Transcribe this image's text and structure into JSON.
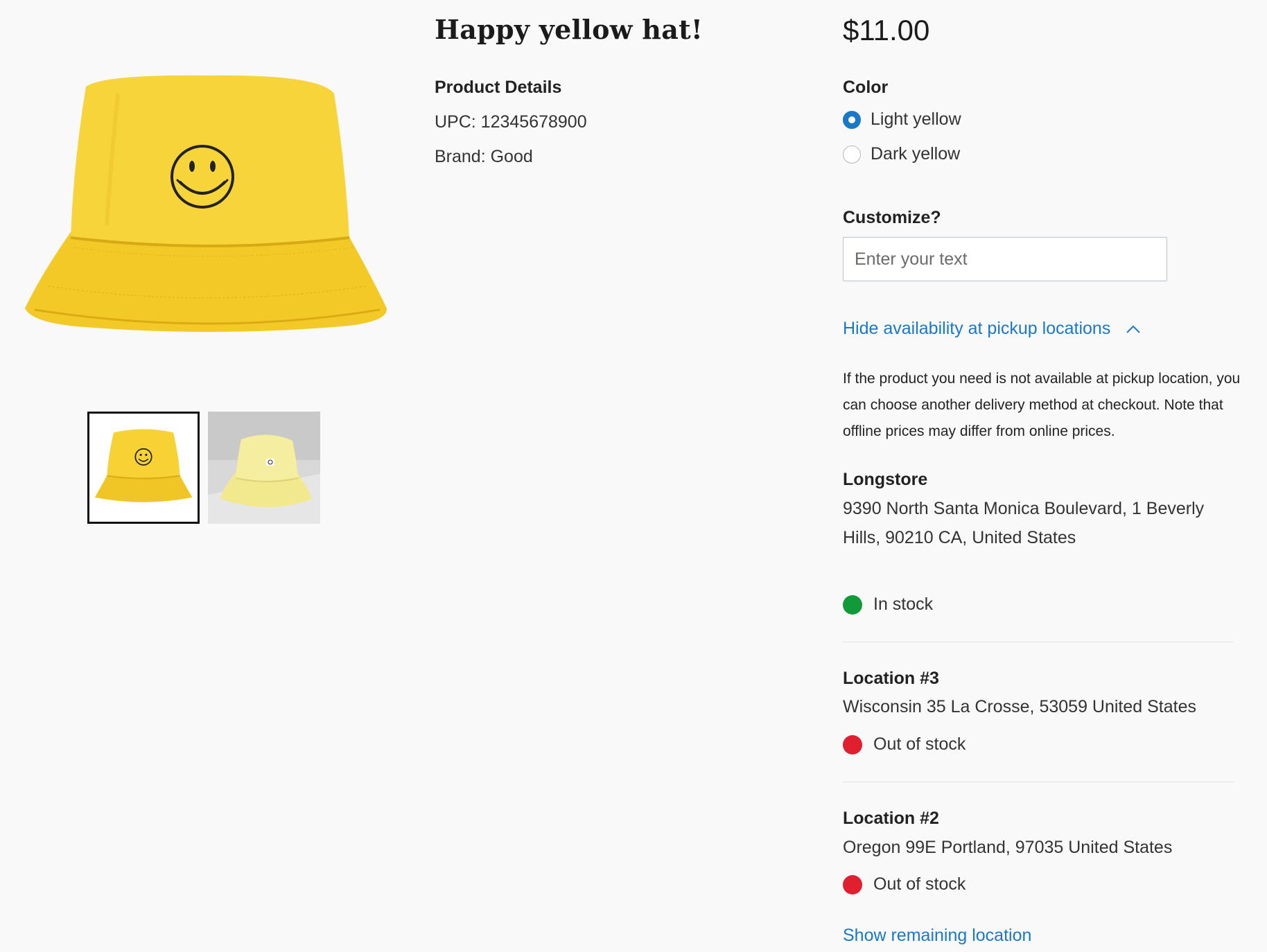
{
  "product": {
    "title": "Happy yellow hat!",
    "price": "$11.00",
    "details_heading": "Product Details",
    "upc": "UPC: 12345678900",
    "brand": "Brand: Good"
  },
  "gallery": {
    "thumbnails": [
      {
        "color": "#f5d330",
        "selected": true
      },
      {
        "color": "#f3ea94",
        "selected": false
      }
    ]
  },
  "color_selector": {
    "heading": "Color",
    "options": [
      {
        "label": "Light yellow",
        "selected": true
      },
      {
        "label": "Dark yellow",
        "selected": false
      }
    ]
  },
  "customize": {
    "heading": "Customize?",
    "placeholder": "Enter your text",
    "value": ""
  },
  "availability": {
    "toggle_label": "Hide availability at pickup locations",
    "note": "If the product you need is not available at pickup location, you can choose another delivery method at checkout. Note that offline prices may differ from online prices.",
    "locations": [
      {
        "name": "Longstore",
        "address": "9390 North Santa Monica Boulevard, 1 Beverly Hills, 90210 CA, United States",
        "status": "In stock",
        "status_color": "#129a3a"
      },
      {
        "name": "Location #3",
        "address": "Wisconsin 35 La Crosse, 53059 United States",
        "status": "Out of stock",
        "status_color": "#e0202f"
      },
      {
        "name": "Location #2",
        "address": "Oregon 99E Portland, 97035 United States",
        "status": "Out of stock",
        "status_color": "#e0202f"
      }
    ],
    "show_remaining_label": "Show remaining location"
  },
  "theme": {
    "link_color": "#1a78c8",
    "background": "#f9f9f9"
  }
}
